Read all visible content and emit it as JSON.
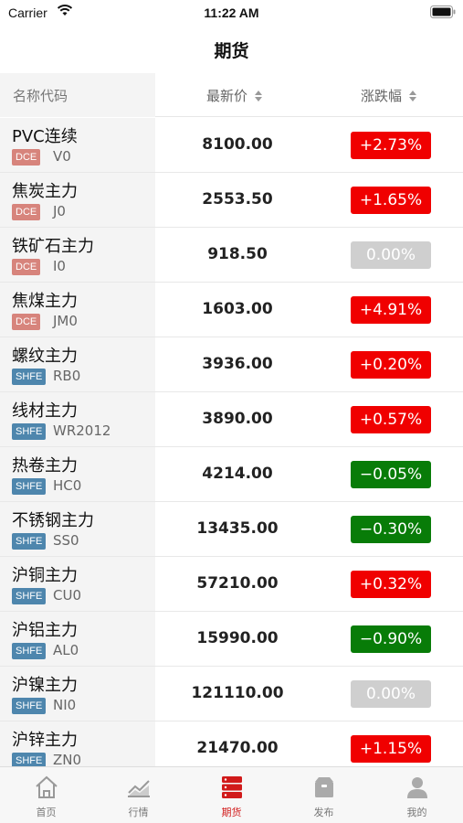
{
  "status": {
    "carrier": "Carrier",
    "time": "11:22 AM"
  },
  "nav": {
    "title": "期货"
  },
  "table": {
    "headers": {
      "name": "名称代码",
      "price": "最新价",
      "change": "涨跌幅"
    },
    "rows": [
      {
        "name": "PVC连续",
        "exchange": "DCE",
        "code": "V0",
        "price": "8100.00",
        "change": "+2.73%",
        "dir": "up"
      },
      {
        "name": "焦炭主力",
        "exchange": "DCE",
        "code": "J0",
        "price": "2553.50",
        "change": "+1.65%",
        "dir": "up"
      },
      {
        "name": "铁矿石主力",
        "exchange": "DCE",
        "code": "I0",
        "price": "918.50",
        "change": "0.00%",
        "dir": "flat"
      },
      {
        "name": "焦煤主力",
        "exchange": "DCE",
        "code": "JM0",
        "price": "1603.00",
        "change": "+4.91%",
        "dir": "up"
      },
      {
        "name": "螺纹主力",
        "exchange": "SHFE",
        "code": "RB0",
        "price": "3936.00",
        "change": "+0.20%",
        "dir": "up"
      },
      {
        "name": "线材主力",
        "exchange": "SHFE",
        "code": "WR2012",
        "price": "3890.00",
        "change": "+0.57%",
        "dir": "up"
      },
      {
        "name": "热卷主力",
        "exchange": "SHFE",
        "code": "HC0",
        "price": "4214.00",
        "change": "−0.05%",
        "dir": "down"
      },
      {
        "name": "不锈钢主力",
        "exchange": "SHFE",
        "code": "SS0",
        "price": "13435.00",
        "change": "−0.30%",
        "dir": "down"
      },
      {
        "name": "沪铜主力",
        "exchange": "SHFE",
        "code": "CU0",
        "price": "57210.00",
        "change": "+0.32%",
        "dir": "up"
      },
      {
        "name": "沪铝主力",
        "exchange": "SHFE",
        "code": "AL0",
        "price": "15990.00",
        "change": "−0.90%",
        "dir": "down"
      },
      {
        "name": "沪镍主力",
        "exchange": "SHFE",
        "code": "NI0",
        "price": "121110.00",
        "change": "0.00%",
        "dir": "flat"
      },
      {
        "name": "沪锌主力",
        "exchange": "SHFE",
        "code": "ZN0",
        "price": "21470.00",
        "change": "+1.15%",
        "dir": "up"
      }
    ]
  },
  "tabs": [
    {
      "label": "首页",
      "icon": "home-icon"
    },
    {
      "label": "行情",
      "icon": "market-chart-icon"
    },
    {
      "label": "期货",
      "icon": "futures-server-icon",
      "active": true
    },
    {
      "label": "发布",
      "icon": "publish-box-icon"
    },
    {
      "label": "我的",
      "icon": "profile-icon"
    }
  ],
  "colors": {
    "up": "#f00000",
    "down": "#087c08",
    "flat": "#cfcfcf",
    "tab_active": "#d11a1a",
    "dce_badge": "#d7847c",
    "shfe_badge": "#4e86ad"
  }
}
